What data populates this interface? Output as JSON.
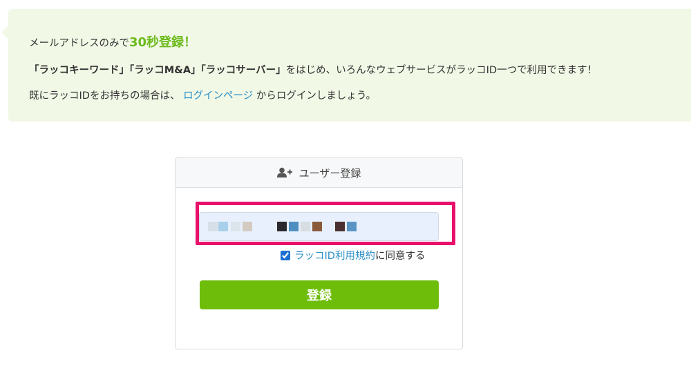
{
  "notice": {
    "line1_prefix": "メールアドレスのみで",
    "line1_highlight": "30秒登録！",
    "line2_services": [
      "「ラッコキーワード」",
      "「ラッコM&A」",
      "「ラッコサーバー」"
    ],
    "line2_suffix": "をはじめ、いろんなウェブサービスがラッコID一つで利用できます！",
    "line3_prefix": "既にラッコIDをお持ちの場合は、",
    "line3_link": "ログインページ",
    "line3_suffix": "からログインしましょう。"
  },
  "card": {
    "title": "ユーザー登録",
    "icon": "user-plus-icon"
  },
  "form": {
    "agree_checked": true,
    "agree_link": "ラッコID利用規約",
    "agree_suffix": "に同意する",
    "submit_label": "登録"
  },
  "colors": {
    "accent_green": "#6fbd0b",
    "highlight_green": "#6cbb1c",
    "link_blue": "#2a8fc6",
    "annotation_pink": "#e8106a",
    "notice_bg": "#f1f8e6"
  }
}
